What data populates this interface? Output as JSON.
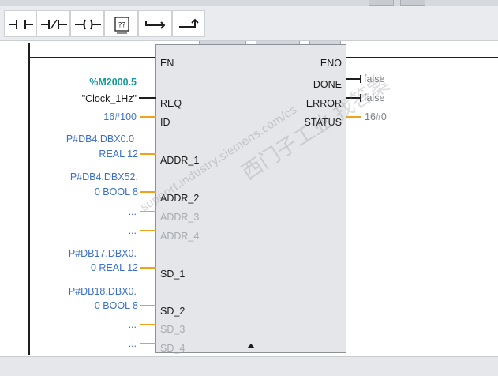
{
  "toolbar": {
    "buttons": [
      {
        "name": "normally-open-contact-icon"
      },
      {
        "name": "normally-closed-contact-icon"
      },
      {
        "name": "output-coil-icon"
      },
      {
        "name": "empty-box-icon",
        "glyph": "??"
      },
      {
        "name": "open-branch-icon"
      },
      {
        "name": "close-branch-icon"
      }
    ]
  },
  "block": {
    "pins_in": {
      "en": "EN",
      "req": "REQ",
      "id": "ID",
      "addr_1": "ADDR_1",
      "addr_2": "ADDR_2",
      "addr_3": "ADDR_3",
      "addr_4": "ADDR_4",
      "sd_1": "SD_1",
      "sd_2": "SD_2",
      "sd_3": "SD_3",
      "sd_4": "SD_4"
    },
    "pins_out": {
      "eno": "ENO",
      "done": "DONE",
      "error": "ERROR",
      "status": "STATUS"
    }
  },
  "operands": {
    "req_tag": "%M2000.5",
    "req_name": "\"Clock_1Hz\"",
    "id": "16#100",
    "addr_1_line1": "P#DB4.DBX0.0",
    "addr_1_line2": "REAL 12",
    "addr_2_line1": "P#DB4.DBX52.",
    "addr_2_line2": "0 BOOL 8",
    "addr_3": "...",
    "addr_4": "...",
    "sd_1_line1": "P#DB17.DBX0.",
    "sd_1_line2": "0 REAL 12",
    "sd_2_line1": "P#DB18.DBX0.",
    "sd_2_line2": "0 BOOL 8",
    "sd_3": "...",
    "sd_4": "..."
  },
  "outputs": {
    "done": "false",
    "error": "false",
    "status": "16#0"
  },
  "watermark": {
    "url": "support.industry.siemens.com/cs",
    "chars": "西门子工业 找答案"
  },
  "colors": {
    "operand": "#3a6fd0",
    "tag": "#139b9b",
    "wire": "#1e1e1e",
    "param_wire": "#f0a21d",
    "block": "#e4e6e9"
  }
}
